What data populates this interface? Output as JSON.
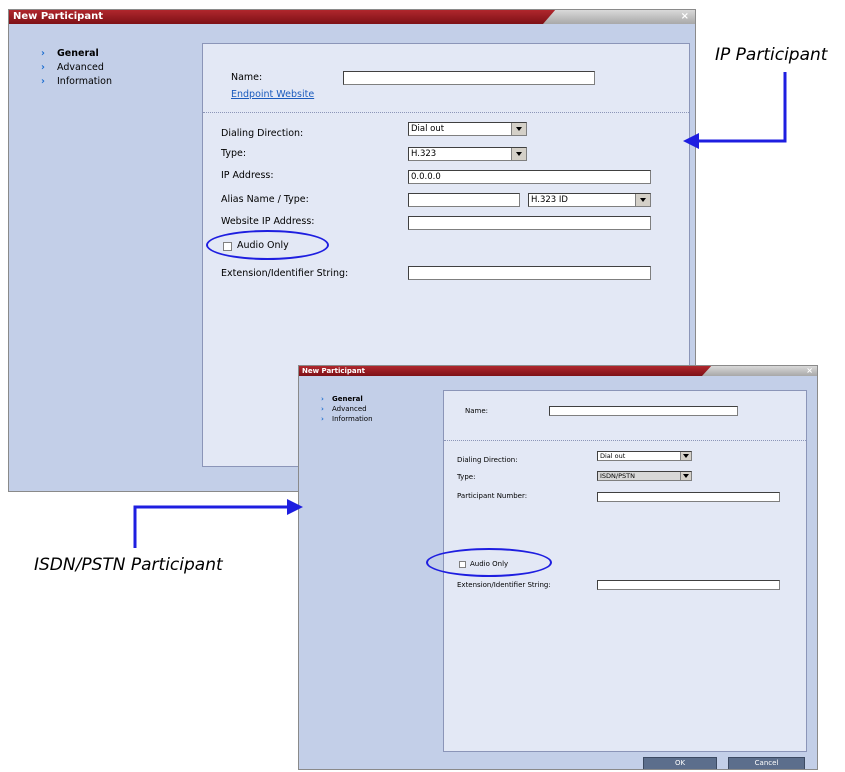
{
  "ip_dialog": {
    "title": "New Participant",
    "close": "×",
    "nav": [
      "General",
      "Advanced",
      "Information"
    ],
    "name_label": "Name:",
    "name_value": "",
    "endpoint_link": "Endpoint Website",
    "dialing_direction_label": "Dialing Direction:",
    "dialing_direction_value": "Dial out",
    "type_label": "Type:",
    "type_value": "H.323",
    "ip_address_label": "IP Address:",
    "ip_address_value": "0.0.0.0",
    "alias_label": "Alias Name / Type:",
    "alias_value": "",
    "alias_type_value": "H.323 ID",
    "website_ip_label": "Website IP Address:",
    "website_ip_value": "",
    "audio_only_label": "Audio Only",
    "extension_label": "Extension/Identifier String:",
    "extension_value": ""
  },
  "isdn_dialog": {
    "title": "New Participant",
    "close": "×",
    "nav": [
      "General",
      "Advanced",
      "Information"
    ],
    "name_label": "Name:",
    "name_value": "",
    "dialing_direction_label": "Dialing Direction:",
    "dialing_direction_value": "Dial out",
    "type_label": "Type:",
    "type_value": "ISDN/PSTN",
    "participant_number_label": "Participant Number:",
    "participant_number_value": "",
    "audio_only_label": "Audio Only",
    "extension_label": "Extension/Identifier String:",
    "extension_value": "",
    "ok_label": "OK",
    "cancel_label": "Cancel"
  },
  "callouts": {
    "ip": "IP Participant",
    "isdn": "ISDN/PSTN Participant"
  },
  "colors": {
    "titlebar": "#a01c22",
    "dialog_bg": "#c3cfe8",
    "panel_bg": "#e3e8f5",
    "highlight_oval": "#1e1ee0",
    "arrow": "#1e1ee0"
  }
}
